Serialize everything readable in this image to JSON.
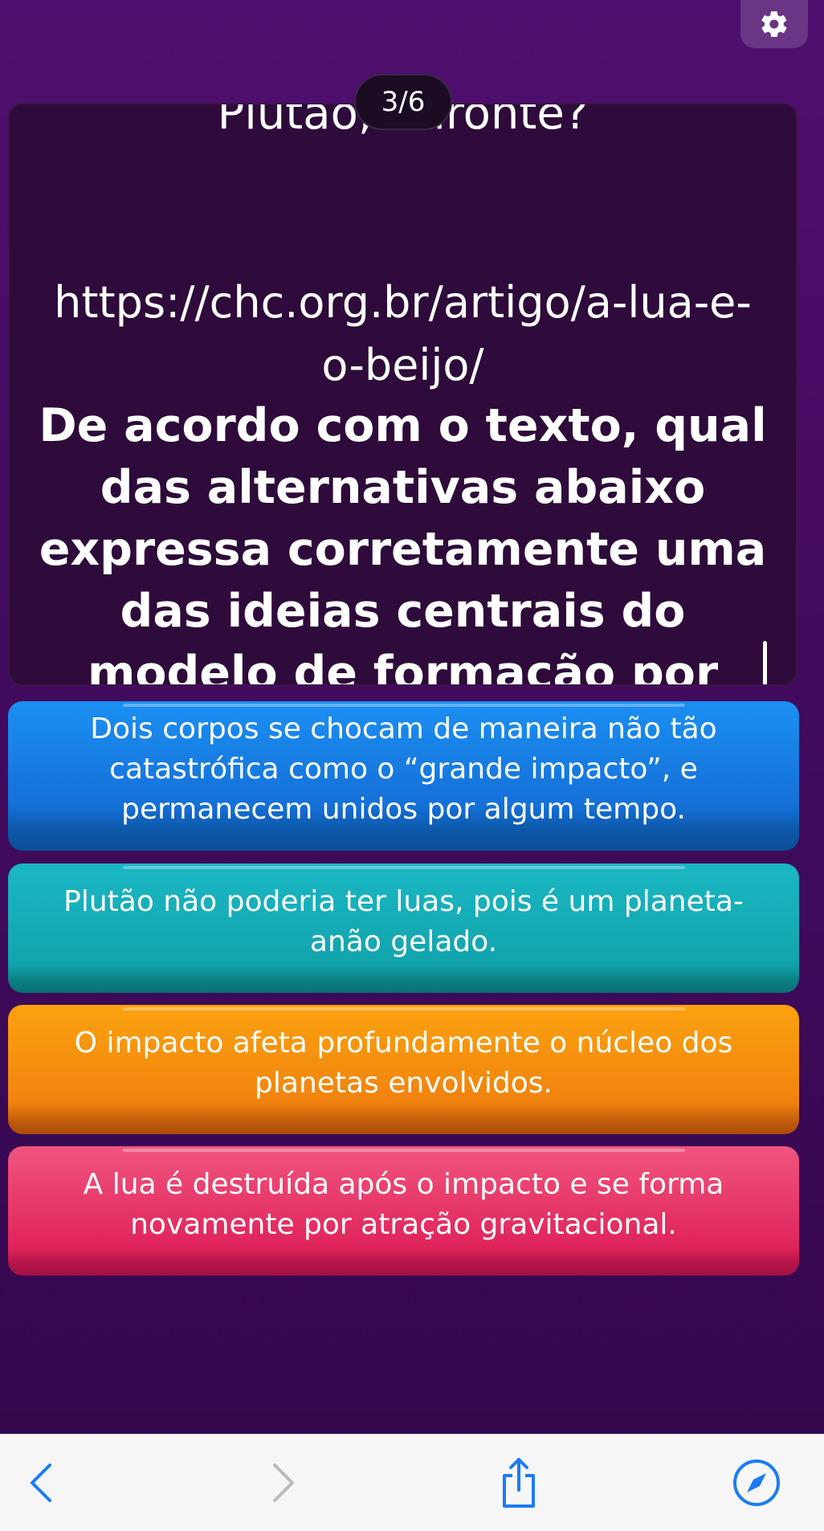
{
  "settings": {
    "icon": "gear-icon"
  },
  "counter": {
    "text": "3/6"
  },
  "question": {
    "cut_line": "Plutão, Caronte?",
    "link": "https://chc.org.br/artigo/a-lua-e-o-beijo/",
    "prompt": "De acordo com o texto, qual das alternativas abaixo expressa corretamente uma das ideias centrais do modelo de formação por “captura e beijo”?"
  },
  "options": [
    {
      "text": "Dois corpos se chocam de maneira não tão catastrófica como o “grande impacto”, e permanecem unidos por algum tempo.",
      "color": "#1b7fe6"
    },
    {
      "text": "Plutão não poderia ter luas, pois é um planeta-anão gelado.",
      "color": "#12a8b1"
    },
    {
      "text": "O impacto afeta profundamente o núcleo dos planetas envolvidos.",
      "color": "#f38d10"
    },
    {
      "text": "A lua é destruída após o impacto e se forma novamente por atração gravitacional.",
      "color": "#e5336a"
    }
  ],
  "browser": {
    "icons": [
      "back-icon",
      "forward-icon",
      "share-icon",
      "compass-icon"
    ],
    "accent": "#1a7cf5"
  }
}
